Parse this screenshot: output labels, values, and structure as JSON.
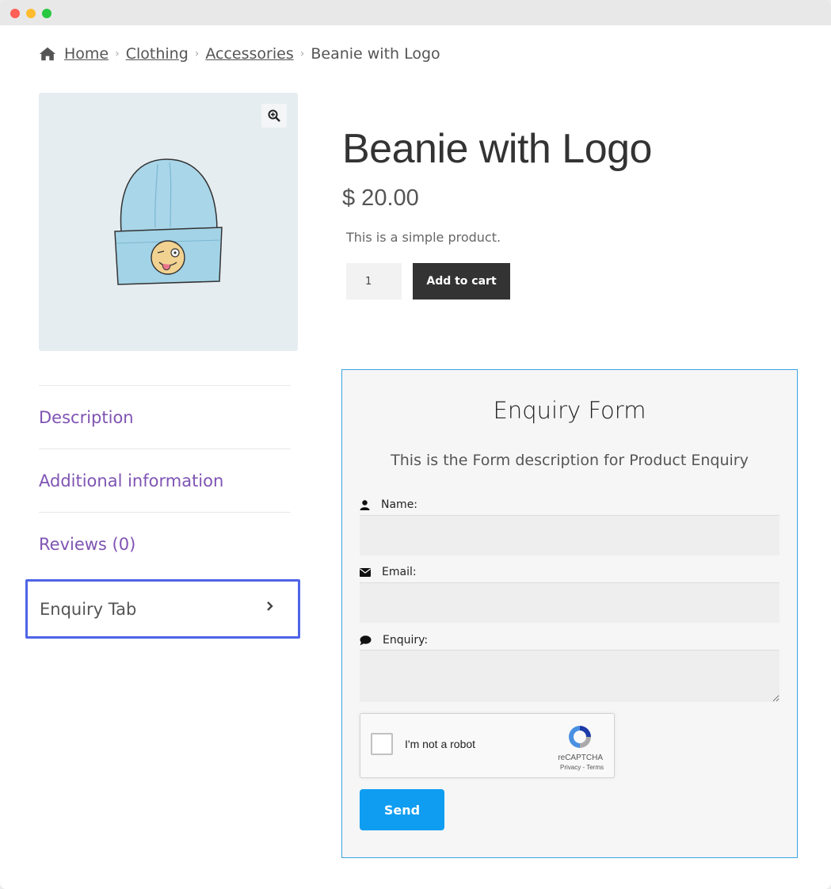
{
  "breadcrumb": {
    "items": [
      {
        "label": "Home"
      },
      {
        "label": "Clothing"
      },
      {
        "label": "Accessories"
      }
    ],
    "current": "Beanie with Logo"
  },
  "product": {
    "title": "Beanie with Logo",
    "price": "$ 20.00",
    "short_description": "This is a simple product.",
    "quantity": "1",
    "add_to_cart_label": "Add to cart"
  },
  "tabs": {
    "items": [
      {
        "label": "Description"
      },
      {
        "label": "Additional information"
      },
      {
        "label": "Reviews (0)"
      }
    ],
    "active": "Enquiry Tab"
  },
  "enquiry_form": {
    "title": "Enquiry Form",
    "description": "This is the Form description for Product Enquiry",
    "name_label": "Name:",
    "email_label": "Email:",
    "enquiry_label": "Enquiry:",
    "captcha_label": "I'm not a robot",
    "captcha_brand": "reCAPTCHA",
    "captcha_links": "Privacy - Terms",
    "send_label": "Send"
  },
  "colors": {
    "tab_link": "#7f54b3",
    "active_outline": "#4f64e6",
    "send_button": "#0f9df2",
    "form_border": "#3aa3e3"
  }
}
